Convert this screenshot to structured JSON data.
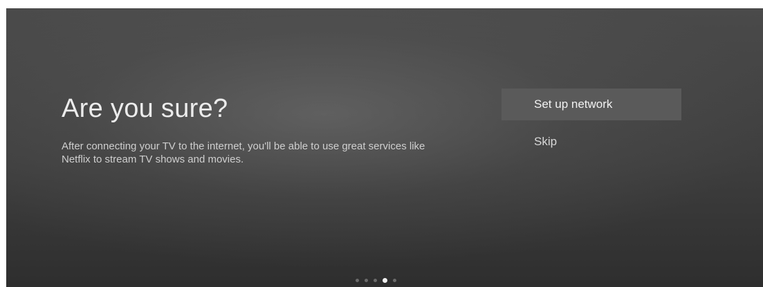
{
  "dialog": {
    "title": "Are you sure?",
    "description": "After connecting your TV to the internet, you'll be able to use great services like Netflix to stream TV shows and movies."
  },
  "options": [
    {
      "label": "Set up network",
      "focused": true
    },
    {
      "label": "Skip",
      "focused": false
    }
  ],
  "pager": {
    "total_pages": 5,
    "current_page": 4
  },
  "colors": {
    "background": "#3e3e3e",
    "focus_highlight": "#5a5a5a",
    "active_dot": "#f0f0f0",
    "inactive_dot": "#6b6b6b"
  }
}
